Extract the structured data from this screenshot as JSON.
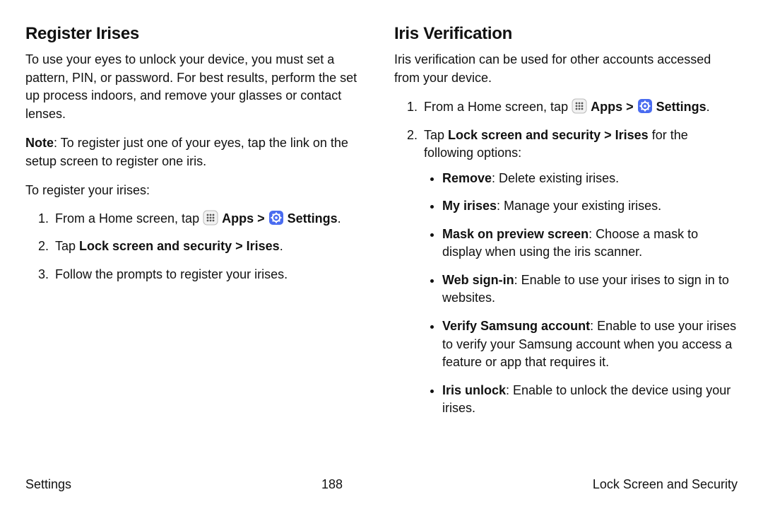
{
  "left": {
    "heading": "Register Irises",
    "intro": "To use your eyes to unlock your device, you must set a pattern, PIN, or password. For best results, perform the set up process indoors, and remove your glasses or contact lenses.",
    "note_label": "Note",
    "note_text": ": To register just one of your eyes, tap the link on the setup screen to register one iris.",
    "lead": "To register your irises:",
    "step1_pre": "From a Home screen, tap ",
    "apps_label": "Apps",
    "arrow": " > ",
    "settings_label": "Settings",
    "period": ".",
    "step2_pre": "Tap ",
    "step2_bold": "Lock screen and security > Irises",
    "step3": "Follow the prompts to register your irises."
  },
  "right": {
    "heading": "Iris Verification",
    "intro": "Iris verification can be used for other accounts accessed from your device.",
    "step1_pre": "From a Home screen, tap ",
    "apps_label": "Apps",
    "arrow": " > ",
    "settings_label": "Settings",
    "period": ".",
    "step2_pre": "Tap ",
    "step2_bold": "Lock screen and security > Irises",
    "step2_post": " for the following options:",
    "bullets": [
      {
        "label": "Remove",
        "text": ": Delete existing irises."
      },
      {
        "label": "My irises",
        "text": ": Manage your existing irises."
      },
      {
        "label": "Mask on preview screen",
        "text": ": Choose a mask to display when using the iris scanner."
      },
      {
        "label": "Web sign-in",
        "text": ": Enable to use your irises to sign in to websites."
      },
      {
        "label": "Verify Samsung account",
        "text": ": Enable to use your irises to verify your Samsung account when you access a feature or app that requires it."
      },
      {
        "label": "Iris unlock",
        "text": ": Enable to unlock the device using your irises."
      }
    ]
  },
  "footer": {
    "left": "Settings",
    "center": "188",
    "right": "Lock Screen and Security"
  }
}
